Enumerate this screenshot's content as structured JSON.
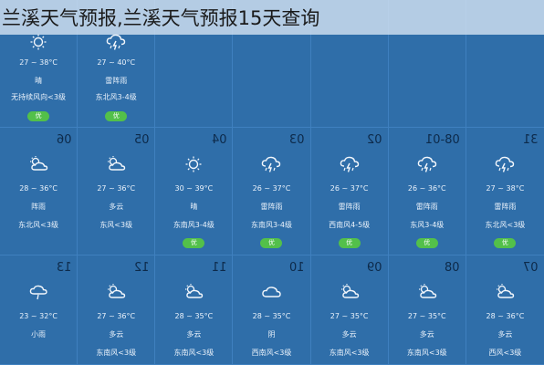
{
  "title": "兰溪天气预报,兰溪天气预报15天查询",
  "row1": [
    {
      "icon": "sun-icon",
      "temp": "27 ~ 38°C",
      "cond": "晴",
      "wind": "无持续风向<3级",
      "badge": "优"
    },
    {
      "icon": "thunder-rain-icon",
      "temp": "27 ~ 40°C",
      "cond": "雷阵雨",
      "wind": "东北风3-4级",
      "badge": "优"
    }
  ],
  "row2": [
    {
      "day": "06",
      "icon": "partly-cloudy-icon",
      "temp": "28 ~ 36°C",
      "cond": "阵雨",
      "wind": "东北风<3级",
      "badge": ""
    },
    {
      "day": "05",
      "icon": "partly-cloudy-icon",
      "temp": "27 ~ 36°C",
      "cond": "多云",
      "wind": "东风<3级",
      "badge": ""
    },
    {
      "day": "04",
      "icon": "sun-icon",
      "temp": "30 ~ 39°C",
      "cond": "晴",
      "wind": "东南风3-4级",
      "badge": "优"
    },
    {
      "day": "03",
      "icon": "thunder-rain-icon",
      "temp": "26 ~ 37°C",
      "cond": "雷阵雨",
      "wind": "东南风3-4级",
      "badge": "优"
    },
    {
      "day": "02",
      "icon": "thunder-rain-icon",
      "temp": "26 ~ 37°C",
      "cond": "雷阵雨",
      "wind": "西南风4-5级",
      "badge": "优"
    },
    {
      "day": "08-01",
      "icon": "thunder-rain-icon",
      "temp": "26 ~ 36°C",
      "cond": "雷阵雨",
      "wind": "东风3-4级",
      "badge": "优"
    },
    {
      "day": "31",
      "icon": "thunder-rain-icon",
      "temp": "27 ~ 38°C",
      "cond": "雷阵雨",
      "wind": "东北风<3级",
      "badge": "优"
    }
  ],
  "row3": [
    {
      "day": "13",
      "icon": "rain-icon",
      "temp": "23 ~ 32°C",
      "cond": "小雨",
      "wind": ""
    },
    {
      "day": "12",
      "icon": "partly-cloudy-icon",
      "temp": "27 ~ 36°C",
      "cond": "多云",
      "wind": "东南风<3级"
    },
    {
      "day": "11",
      "icon": "partly-cloudy-icon",
      "temp": "28 ~ 35°C",
      "cond": "多云",
      "wind": "东南风<3级"
    },
    {
      "day": "10",
      "icon": "cloud-icon",
      "temp": "28 ~ 35°C",
      "cond": "阴",
      "wind": "西南风<3级"
    },
    {
      "day": "09",
      "icon": "partly-cloudy-icon",
      "temp": "27 ~ 35°C",
      "cond": "多云",
      "wind": "东南风<3级"
    },
    {
      "day": "08",
      "icon": "partly-cloudy-icon",
      "temp": "27 ~ 35°C",
      "cond": "多云",
      "wind": "东南风<3级"
    },
    {
      "day": "07",
      "icon": "partly-cloudy-icon",
      "temp": "28 ~ 36°C",
      "cond": "多云",
      "wind": "西风<3级"
    }
  ],
  "colors": {
    "background": "#2f6ea9",
    "badge": "#53c04a"
  }
}
